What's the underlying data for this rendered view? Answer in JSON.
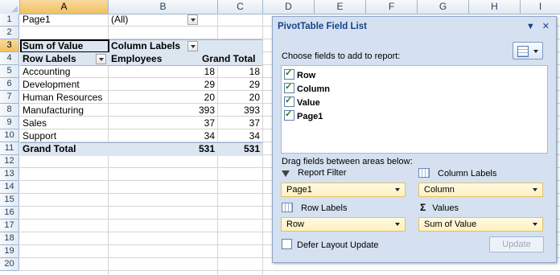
{
  "columns": [
    "A",
    "B",
    "C",
    "D",
    "E",
    "F",
    "G",
    "H",
    "I"
  ],
  "rows": [
    "1",
    "2",
    "3",
    "4",
    "5",
    "6",
    "7",
    "8",
    "9",
    "10",
    "11",
    "12",
    "13",
    "14",
    "15",
    "16",
    "17",
    "18",
    "19",
    "20"
  ],
  "pivot": {
    "filter_label": "Page1",
    "filter_value": "(All)",
    "sum_label": "Sum of Value",
    "col_labels": "Column Labels",
    "row_labels": "Row Labels",
    "employees": "Employees",
    "grand_total": "Grand Total",
    "data_rows": [
      {
        "label": "Accounting",
        "b": "18",
        "c": "18"
      },
      {
        "label": "Development",
        "b": "29",
        "c": "29"
      },
      {
        "label": "Human Resources",
        "b": "20",
        "c": "20"
      },
      {
        "label": "Manufacturing",
        "b": "393",
        "c": "393"
      },
      {
        "label": "Sales",
        "b": "37",
        "c": "37"
      },
      {
        "label": "Support",
        "b": "34",
        "c": "34"
      }
    ],
    "total_row": {
      "label": "Grand Total",
      "b": "531",
      "c": "531"
    }
  },
  "field_list": {
    "title": "PivotTable Field List",
    "close_glyph": "✕",
    "menu_glyph": "▼",
    "choose_text": "Choose fields to add to report:",
    "fields": [
      "Row",
      "Column",
      "Value",
      "Page1"
    ],
    "drag_hint": "Drag fields between areas below:",
    "areas": {
      "report_filter": {
        "label": "Report Filter",
        "value": "Page1"
      },
      "column_labels": {
        "label": "Column Labels",
        "value": "Column"
      },
      "row_labels": {
        "label": "Row Labels",
        "value": "Row"
      },
      "values": {
        "label": "Values",
        "value": "Sum of Value"
      }
    },
    "sigma_glyph": "Σ",
    "defer_label": "Defer Layout Update",
    "update_label": "Update"
  },
  "colors": {
    "header_selected": "#f1c15f",
    "pivot_header": "#dce6f1",
    "pane_bg": "#d5e1f0"
  }
}
